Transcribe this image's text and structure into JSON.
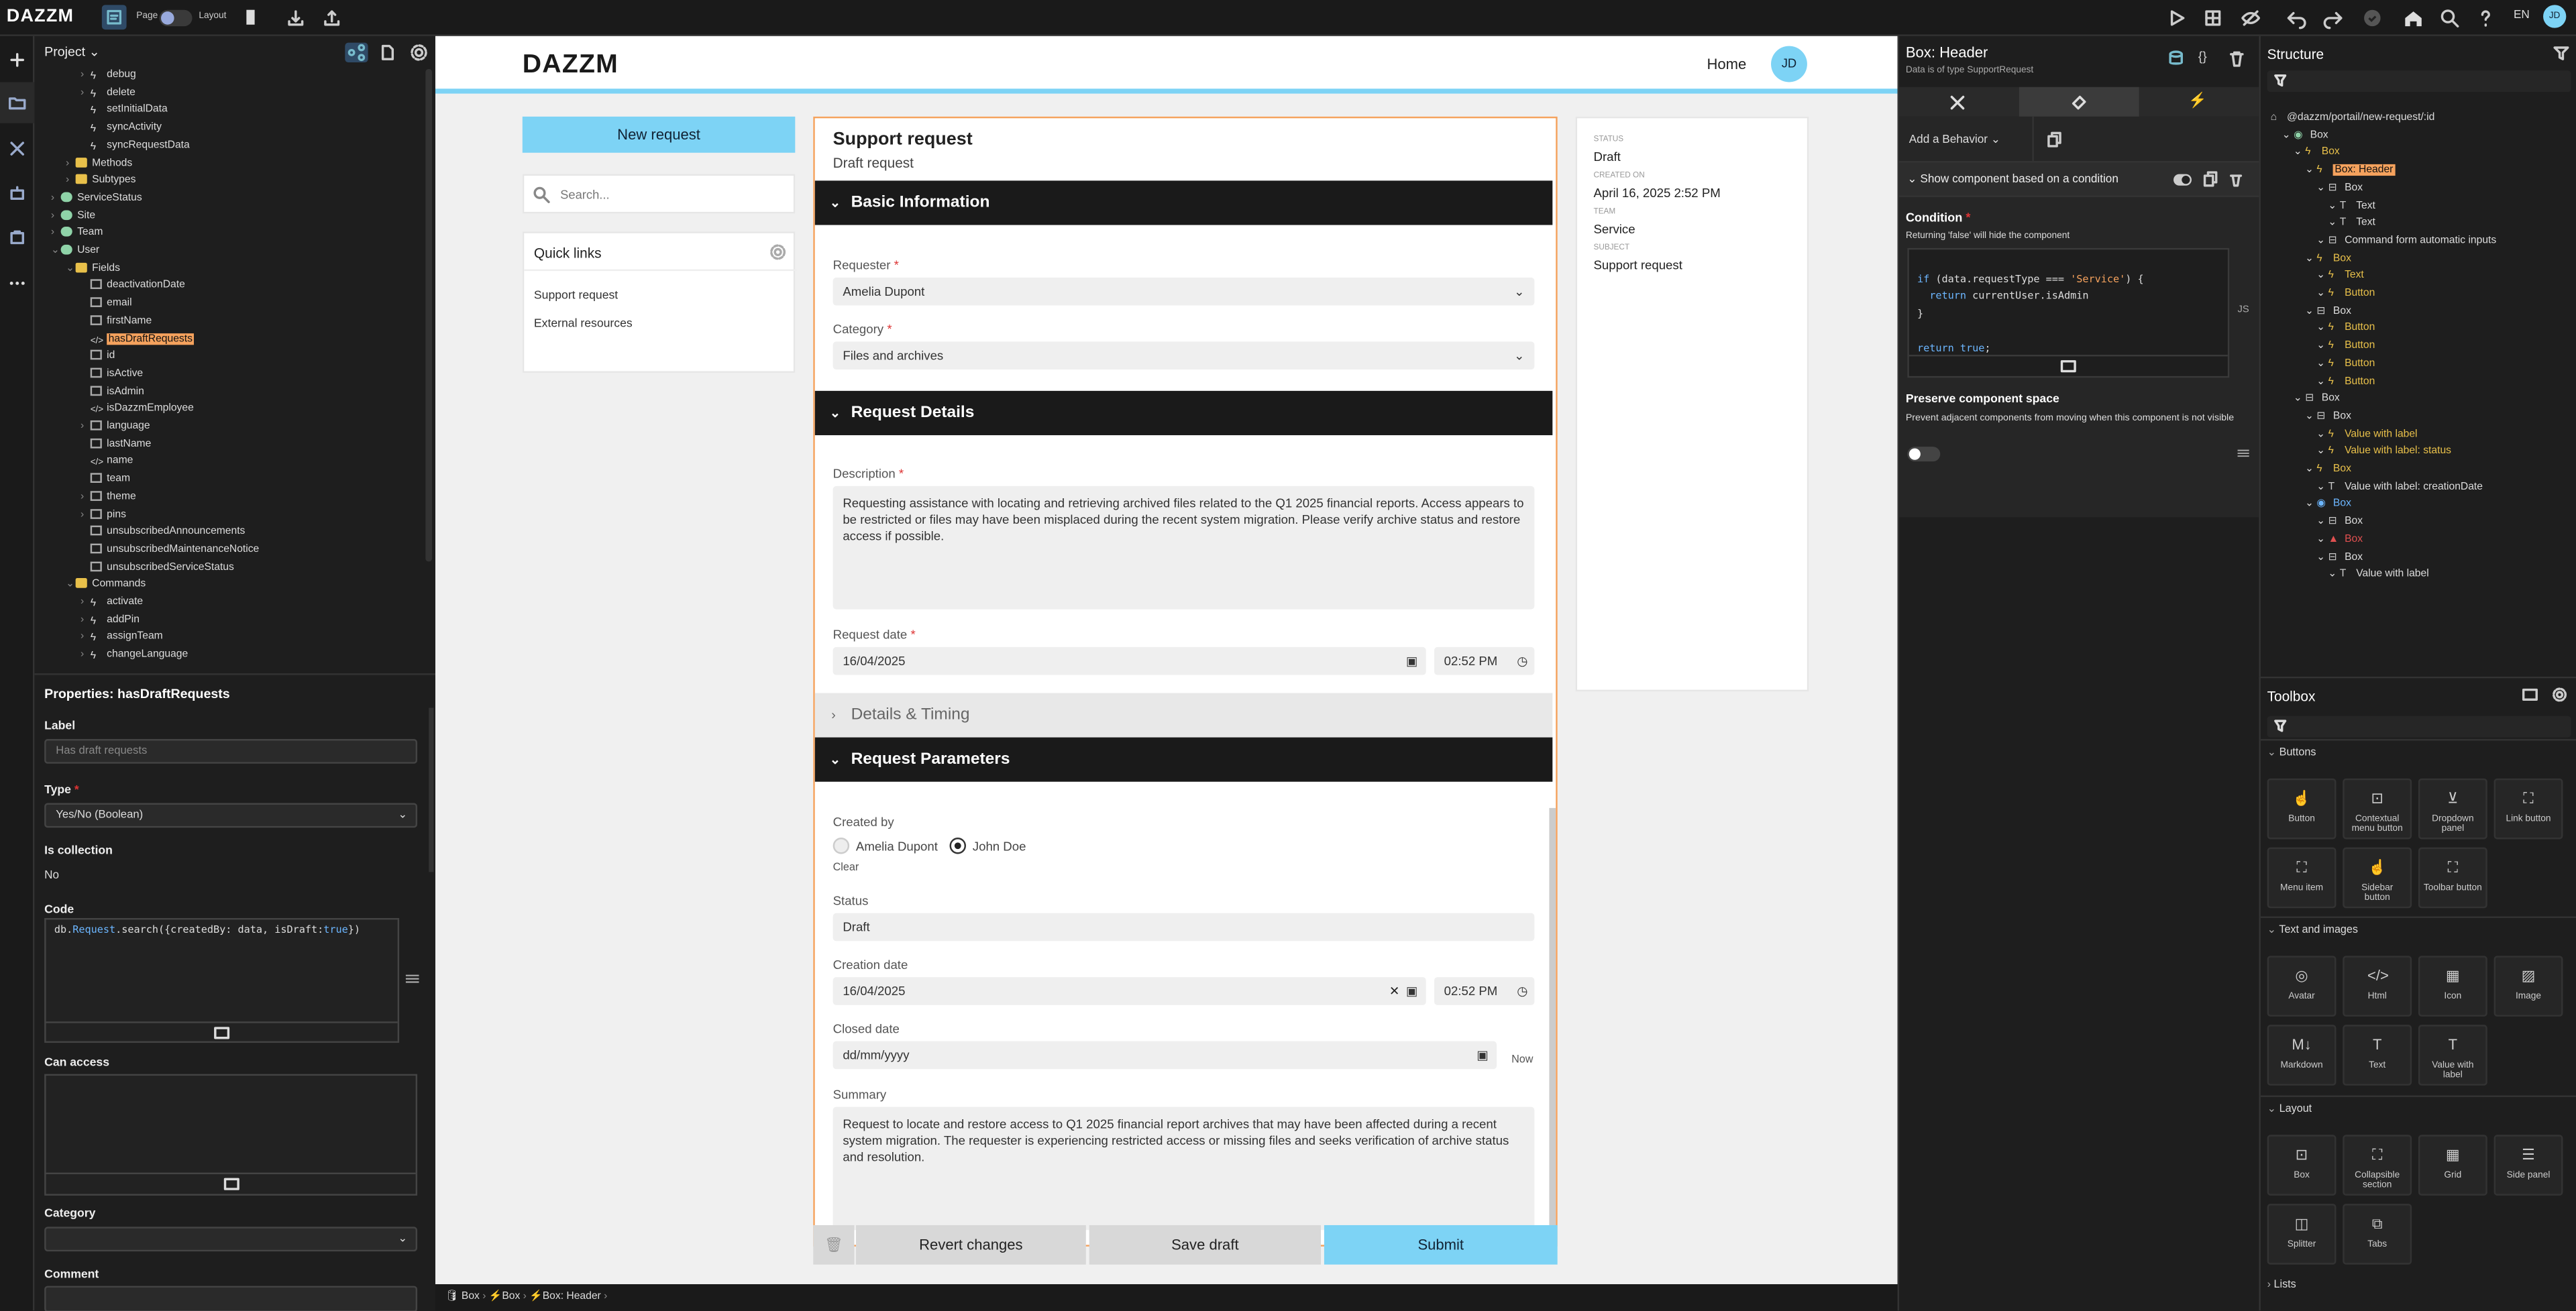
{
  "topbar": {
    "logo": "DAZZM",
    "page_label": "Page",
    "layout_label": "Layout",
    "lang": "EN",
    "avatar": "JD"
  },
  "project": {
    "title": "Project",
    "tree": [
      {
        "label": "debug",
        "icon": "lightning-icon",
        "indent": 2
      },
      {
        "label": "delete",
        "icon": "lightning-icon",
        "indent": 2
      },
      {
        "label": "setInitialData",
        "icon": "lightning-icon",
        "indent": 2
      },
      {
        "label": "syncActivity",
        "icon": "lightning-icon",
        "indent": 2
      },
      {
        "label": "syncRequestData",
        "icon": "lightning-icon",
        "indent": 2
      },
      {
        "label": "Methods",
        "icon": "folder-icon",
        "indent": 1
      },
      {
        "label": "Subtypes",
        "icon": "folder-icon",
        "indent": 1
      },
      {
        "label": "ServiceStatus",
        "icon": "db-icon",
        "indent": 0
      },
      {
        "label": "Site",
        "icon": "db-icon",
        "indent": 0
      },
      {
        "label": "Team",
        "icon": "db-icon",
        "indent": 0
      },
      {
        "label": "User",
        "icon": "db-icon",
        "indent": 0
      },
      {
        "label": "Fields",
        "icon": "folder-icon",
        "indent": 1
      },
      {
        "label": "deactivationDate",
        "icon": "field-icon",
        "indent": 2
      },
      {
        "label": "email",
        "icon": "field-icon",
        "indent": 2
      },
      {
        "label": "firstName",
        "icon": "field-icon",
        "indent": 2
      },
      {
        "label": "hasDraftRequests",
        "icon": "code-icon",
        "indent": 2
      },
      {
        "label": "id",
        "icon": "field-icon",
        "indent": 2
      },
      {
        "label": "isActive",
        "icon": "field-icon",
        "indent": 2
      },
      {
        "label": "isAdmin",
        "icon": "field-icon",
        "indent": 2
      },
      {
        "label": "isDazzmEmployee",
        "icon": "code-icon",
        "indent": 2
      },
      {
        "label": "language",
        "icon": "field-icon",
        "indent": 2
      },
      {
        "label": "lastName",
        "icon": "field-icon",
        "indent": 2
      },
      {
        "label": "name",
        "icon": "code-icon",
        "indent": 2
      },
      {
        "label": "team",
        "icon": "field-icon",
        "indent": 2
      },
      {
        "label": "theme",
        "icon": "field-icon",
        "indent": 2
      },
      {
        "label": "pins",
        "icon": "field-icon",
        "indent": 2
      },
      {
        "label": "unsubscribedAnnouncements",
        "icon": "field-icon",
        "indent": 2
      },
      {
        "label": "unsubscribedMaintenanceNotice",
        "icon": "field-icon",
        "indent": 2
      },
      {
        "label": "unsubscribedServiceStatus",
        "icon": "field-icon",
        "indent": 2
      },
      {
        "label": "Commands",
        "icon": "folder-icon",
        "indent": 1
      },
      {
        "label": "activate",
        "icon": "lightning-icon",
        "indent": 2
      },
      {
        "label": "addPin",
        "icon": "lightning-icon",
        "indent": 2
      },
      {
        "label": "assignTeam",
        "icon": "lightning-icon",
        "indent": 2
      },
      {
        "label": "changeLanguage",
        "icon": "lightning-icon",
        "indent": 2
      }
    ]
  },
  "properties": {
    "title": "Properties: hasDraftRequests",
    "label_label": "Label",
    "label_placeholder": "Has draft requests",
    "type_label": "Type",
    "type_value": "Yes/No (Boolean)",
    "collection_label": "Is collection",
    "collection_value": "No",
    "code_label": "Code",
    "code_parts": [
      "db.",
      "Request",
      ".search({createdBy: data, isDraft:",
      "true",
      "})"
    ],
    "access_label": "Can access",
    "category_label": "Category",
    "comment_label": "Comment"
  },
  "app": {
    "logo": "DAZZM",
    "home": "Home",
    "avatar": "JD",
    "new_request": "New request",
    "search_placeholder": "Search...",
    "quick_links_title": "Quick links",
    "quick_links": [
      "Support request",
      "External resources"
    ]
  },
  "form": {
    "title": "Support request",
    "subtitle": "Draft request",
    "sections": {
      "basic": "Basic Information",
      "details": "Request Details",
      "timing": "Details & Timing",
      "params": "Request Parameters"
    },
    "requester_label": "Requester",
    "requester_value": "Amelia Dupont",
    "category_label": "Category",
    "category_value": "Files and archives",
    "description_label": "Description",
    "description_value": "Requesting assistance with locating and retrieving archived files related to the Q1 2025 financial reports. Access appears to be restricted or files may have been misplaced during the recent system migration. Please verify archive status and restore access if possible.",
    "request_date_label": "Request date",
    "request_date": "16/04/2025",
    "request_time": "02:52 PM",
    "created_by_label": "Created by",
    "created_by_options": [
      "Amelia Dupont",
      "John Doe"
    ],
    "created_by_selected": "John Doe",
    "clear": "Clear",
    "status_label": "Status",
    "status_value": "Draft",
    "creation_date_label": "Creation date",
    "creation_date": "16/04/2025",
    "creation_time": "02:52 PM",
    "closed_date_label": "Closed date",
    "closed_date_placeholder": "dd/mm/yyyy",
    "now": "Now",
    "summary_label": "Summary",
    "summary_value": "Request to locate and restore access to Q1 2025 financial report archives that may have been affected during a recent system migration. The requester is experiencing restricted access or missing files and seeks verification of archive status and resolution.",
    "revert": "Revert changes",
    "save": "Save draft",
    "submit": "Submit"
  },
  "summary_card": {
    "status_label": "STATUS",
    "status": "Draft",
    "created_label": "CREATED ON",
    "created": "April 16, 2025 2:52 PM",
    "team_label": "TEAM",
    "team": "Service",
    "subject_label": "SUBJECT",
    "subject": "Support request"
  },
  "breadcrumbs": [
    "Box",
    "Box",
    "Box: Header"
  ],
  "box_header": {
    "title": "Box: Header",
    "subtitle": "Data is of type SupportRequest",
    "add_behavior": "Add a Behavior",
    "behavior": "Show component based on a condition",
    "condition_label": "Condition",
    "condition_hint": "Returning 'false' will hide the component",
    "code": [
      "if (data.requestType === 'Service') {",
      "  return currentUser.isAdmin",
      "}",
      "",
      "return true;"
    ],
    "js": "JS",
    "preserve_title": "Preserve component space",
    "preserve_hint": "Prevent adjacent components from moving when this component is not visible"
  },
  "structure": {
    "title": "Structure",
    "rows": [
      {
        "label": "@dazzm/portail/new-request/:id",
        "kind": "root",
        "indent": 0
      },
      {
        "label": "Box",
        "kind": "db",
        "indent": 1
      },
      {
        "label": "Box",
        "kind": "lightning",
        "indent": 2,
        "color": "yellow"
      },
      {
        "label": "Box: Header",
        "kind": "lightning",
        "indent": 3,
        "color": "highlight"
      },
      {
        "label": "Box",
        "kind": "box",
        "indent": 4
      },
      {
        "label": "Text",
        "kind": "text",
        "indent": 5
      },
      {
        "label": "Text",
        "kind": "text",
        "indent": 5
      },
      {
        "label": "Command form automatic inputs",
        "kind": "box",
        "indent": 4
      },
      {
        "label": "Box",
        "kind": "lightning",
        "indent": 3,
        "color": "yellow"
      },
      {
        "label": "Text",
        "kind": "lightning",
        "indent": 4,
        "color": "yellow"
      },
      {
        "label": "Button",
        "kind": "lightning",
        "indent": 4,
        "color": "yellow"
      },
      {
        "label": "Box",
        "kind": "box",
        "indent": 3
      },
      {
        "label": "Button",
        "kind": "lightning",
        "indent": 4,
        "color": "yellow"
      },
      {
        "label": "Button",
        "kind": "lightning",
        "indent": 4,
        "color": "yellow"
      },
      {
        "label": "Button",
        "kind": "lightning",
        "indent": 4,
        "color": "yellow"
      },
      {
        "label": "Button",
        "kind": "lightning",
        "indent": 4,
        "color": "yellow"
      },
      {
        "label": "Box",
        "kind": "box",
        "indent": 2
      },
      {
        "label": "Box",
        "kind": "box",
        "indent": 3
      },
      {
        "label": "Value with label",
        "kind": "lightning",
        "indent": 4,
        "color": "yellow"
      },
      {
        "label": "Value with label: status",
        "kind": "lightning",
        "indent": 4,
        "color": "yellow"
      },
      {
        "label": "Box",
        "kind": "lightning",
        "indent": 3,
        "color": "yellow"
      },
      {
        "label": "Value with label: creationDate",
        "kind": "text",
        "indent": 4
      },
      {
        "label": "Box",
        "kind": "db",
        "indent": 3,
        "color": "blue"
      },
      {
        "label": "Box",
        "kind": "box",
        "indent": 4
      },
      {
        "label": "Box",
        "kind": "warn",
        "indent": 4,
        "color": "red"
      },
      {
        "label": "Box",
        "kind": "box",
        "indent": 4
      },
      {
        "label": "Value with label",
        "kind": "text",
        "indent": 5
      }
    ]
  },
  "toolbox": {
    "title": "Toolbox",
    "sections": [
      {
        "name": "Buttons",
        "items": [
          "Button",
          "Contextual menu button",
          "Dropdown panel",
          "Link button",
          "Menu item",
          "Sidebar button",
          "Toolbar button"
        ]
      },
      {
        "name": "Text and images",
        "items": [
          "Avatar",
          "Html",
          "Icon",
          "Image",
          "Markdown",
          "Text",
          "Value with label"
        ]
      },
      {
        "name": "Layout",
        "items": [
          "Box",
          "Collapsible section",
          "Grid",
          "Side panel",
          "Splitter",
          "Tabs"
        ]
      },
      {
        "name": "Lists",
        "items": []
      }
    ]
  },
  "colors": {
    "accent": "#7dd3f5",
    "highlight": "#f5a25d",
    "lightning": "#e8c04a",
    "dark": "#1a1a1a"
  }
}
